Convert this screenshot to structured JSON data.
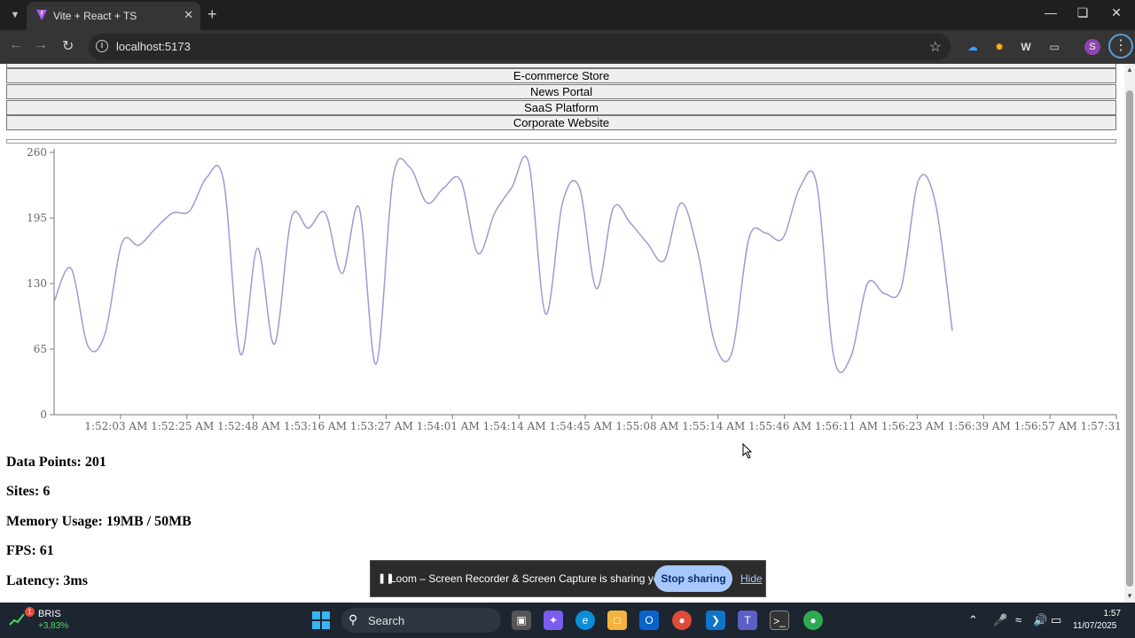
{
  "browser": {
    "tab_title": "Vite + React + TS",
    "url": "localhost:5173",
    "profile_initial": "S"
  },
  "sites": {
    "partial_label": "",
    "items": [
      "E-commerce Store",
      "News Portal",
      "SaaS Platform",
      "Corporate Website"
    ]
  },
  "chart_data": {
    "type": "line",
    "ylim": [
      0,
      260
    ],
    "y_ticks": [
      "0",
      "65",
      "130",
      "195",
      "260"
    ],
    "x_ticks": [
      "1:52:03 AM",
      "1:52:25 AM",
      "1:52:48 AM",
      "1:53:16 AM",
      "1:53:27 AM",
      "1:54:01 AM",
      "1:54:14 AM",
      "1:54:45 AM",
      "1:55:08 AM",
      "1:55:14 AM",
      "1:55:46 AM",
      "1:56:11 AM",
      "1:56:23 AM",
      "1:56:39 AM",
      "1:56:57 AM",
      "1:57:31 AM"
    ],
    "series": [
      {
        "color": "#9b9bd4",
        "values": [
          112,
          145,
          68,
          80,
          170,
          168,
          185,
          200,
          202,
          235,
          232,
          60,
          165,
          70,
          195,
          185,
          200,
          140,
          205,
          50,
          235,
          245,
          210,
          225,
          232,
          160,
          200,
          225,
          250,
          100,
          210,
          225,
          125,
          205,
          190,
          170,
          153,
          210,
          160,
          70,
          62,
          175,
          180,
          175,
          225,
          228,
          58,
          57,
          130,
          120,
          127,
          232,
          210,
          83
        ]
      }
    ]
  },
  "stats": {
    "data_points": "Data Points: 201",
    "sites": "Sites: 6",
    "memory": "Memory Usage: 19MB / 50MB",
    "fps": "FPS: 61",
    "latency": "Latency: 3ms"
  },
  "loom": {
    "message": "Loom – Screen Recorder & Screen Capture is sharing your screen.",
    "stop_label": "Stop sharing",
    "hide_label": "Hide"
  },
  "taskbar": {
    "stock_badge": "1",
    "stock_name": "BRIS",
    "stock_change": "+3,83%",
    "search_label": "Search",
    "time": "1:57",
    "date": "11/07/2025"
  },
  "icons": [
    "chevron-down-icon",
    "vite-logo-icon",
    "close-icon",
    "plus-icon",
    "back-icon",
    "forward-icon",
    "reload-icon",
    "info-icon",
    "star-icon",
    "extension-icon",
    "kebab-menu-icon",
    "windows-start-icon",
    "search-icon"
  ]
}
